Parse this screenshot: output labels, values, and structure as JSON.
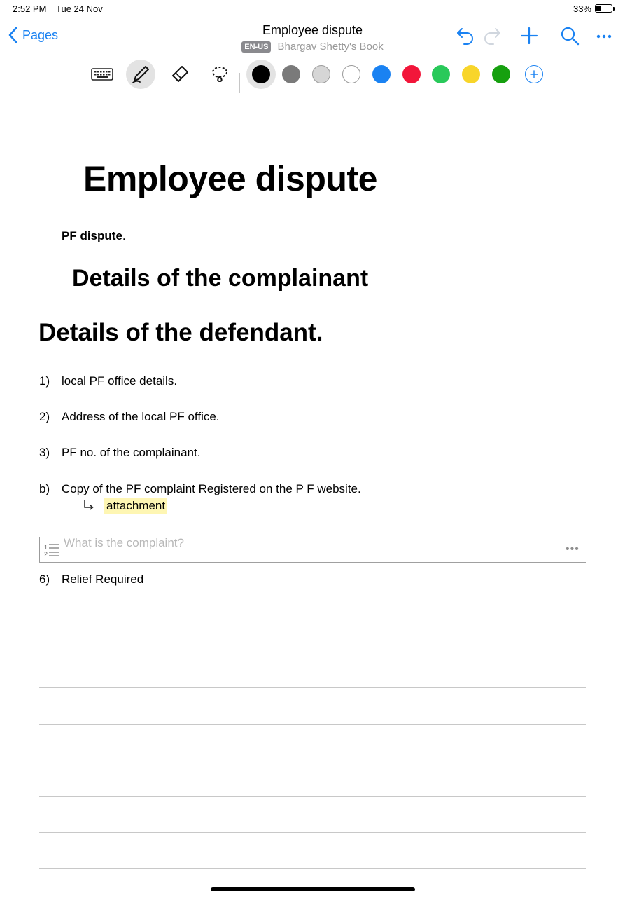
{
  "status": {
    "time": "2:52 PM",
    "date": "Tue 24 Nov",
    "battery_text": "33%",
    "battery_level": 0.33
  },
  "nav": {
    "back_label": "Pages",
    "title": "Employee dispute",
    "lang": "EN-US",
    "book": "Bhargav Shetty's Book"
  },
  "toolbar": {
    "tools": [
      "keyboard-icon",
      "pen-icon",
      "eraser-icon",
      "lasso-icon"
    ],
    "colors": [
      "#000000",
      "#7a7a7a",
      "#d6d6d6",
      "#ffffff",
      "#1a82f2",
      "#f2163a",
      "#29c95a",
      "#f8d52a",
      "#16a00f"
    ],
    "selected_color": "#000000"
  },
  "content": {
    "title": "Employee dispute",
    "pf_bold": "PF dispute",
    "pf_rest": ".",
    "h_complainant": "Details of the complainant",
    "h_defendant": "Details of the defendant.",
    "items": [
      {
        "num": "1)",
        "text": "local PF office details."
      },
      {
        "num": "2)",
        "text": "Address of the local PF office."
      },
      {
        "num": "3)",
        "text": "PF no. of the complainant."
      },
      {
        "num": "b)",
        "text": "Copy of the PF complaint Registered on the P F website."
      }
    ],
    "attachment": "attachment",
    "placeholder": "What is the complaint?",
    "relief_num": "6)",
    "relief_text": "Relief Required"
  }
}
